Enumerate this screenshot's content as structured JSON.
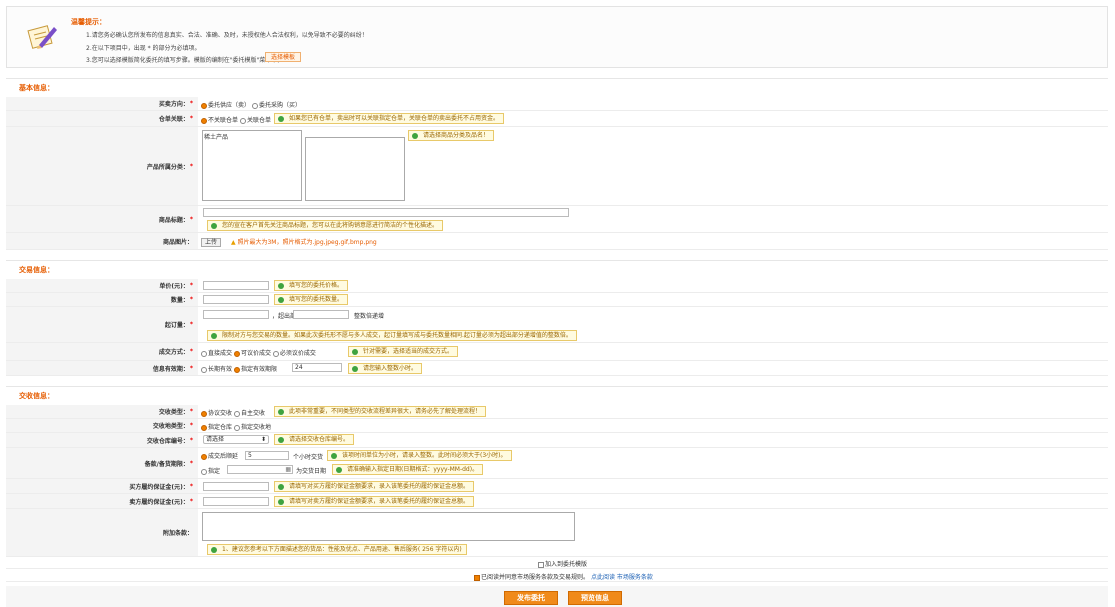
{
  "tips": {
    "title": "温馨提示：",
    "lines": [
      "1.请您务必确认您所发布的信息真实、合法、准确、及时，未授权他人合法权利，以免导致不必要的纠纷！",
      "2.在以下项目中，出现 * 的部分为必填项。",
      "3.您可以选择模版简化委托的填写步骤。模版的编制在\"委托模版\"菜单下。"
    ],
    "template_button": "选择模板"
  },
  "basic": {
    "heading": "基本信息：",
    "direction": {
      "label": "买卖方向：",
      "opt1": "委托供应（卖）",
      "opt2": "委托采购（买）"
    },
    "warehouse": {
      "label": "仓单关联：",
      "opt1": "不关联仓单",
      "opt2": "关联仓单",
      "hint": "如果您已有仓单，卖出时可以关联指定仓单，关联仓单的卖出委托不占用资金。"
    },
    "category": {
      "label": "产品所属分类：",
      "list1": [
        "稀土产品"
      ],
      "hint": "请选择商品分类及品名！"
    },
    "title": {
      "label": "商品标题：",
      "value": "",
      "hint": "您的宣在客户首先关注商品标题，您可以在此将购销意愿进行简洁的个性化描述。"
    },
    "image": {
      "label": "商品图片：",
      "upload": "上传",
      "note": "照片最大为3M，照片格式为.jpg,jpeg,gif,bmp,png"
    }
  },
  "trade": {
    "heading": "交易信息：",
    "price": {
      "label": "单价(元)：",
      "hint": "填写您的委托价格。"
    },
    "qty": {
      "label": "数量：",
      "hint": "填写您的委托数量。"
    },
    "min": {
      "label": "起订量：",
      "mid": "，超出部分按",
      "tail": "整数倍递增",
      "hint": "限制对方与您交易的数量。如果此次委托形不愿与多人成交，起订量填写成与委托数量相同.起订量必须为超出部分递增值的整数倍。"
    },
    "deal": {
      "label": "成交方式：",
      "opt1": "直接成交",
      "opt2": "可议价成交",
      "opt3": "必须议价成交",
      "hint": "针对需要，选择适当的成交方式。"
    },
    "valid": {
      "label": "信息有效期：",
      "opt1": "长期有效",
      "opt2": "指定有效期限",
      "value": "24",
      "hint": "请您输入整数小时。"
    }
  },
  "delivery": {
    "heading": "交收信息：",
    "type": {
      "label": "交收类型：",
      "opt1": "协议交收",
      "opt2": "自主交收",
      "hint": "此项非常重要，不同类型的交收流程差异很大，请务必先了解处理流程！"
    },
    "place": {
      "label": "交收地类型：",
      "opt1": "指定仓库",
      "opt2": "指定交收地"
    },
    "wh_no": {
      "label": "交收仓库编号：",
      "select": "请选择",
      "hint": "请选择交收仓库编号。"
    },
    "deadline": {
      "label": "备款/备货期限：",
      "opt1": "成交后顺延",
      "hours": "5",
      "unit": "个小时交货",
      "hint1": "该项时间单位为小时，请录入整数。此时间必须大于(3小时)。",
      "opt2": "指定",
      "suffix": "为交货日期",
      "hint2": "请准确输入指定日期(日期格式：yyyy-MM-dd)。"
    },
    "buyer_dep": {
      "label": "买方履约保证金(元)：",
      "hint": "请填写对买方履约保证金额要求，录入该笔委托的履约保证金总额。"
    },
    "seller_dep": {
      "label": "卖方履约保证金(元)：",
      "hint": "请填写对卖方履约保证金额要求，录入该笔委托的履约保证金总额。"
    },
    "extra": {
      "label": "附加条款：",
      "hint": "1、建议您参考以下方面描述您的货品：性能及优点、产品用途、售后服务( 256 字符以内)"
    }
  },
  "footer": {
    "add_tpl": "加入到委托模版",
    "agree": "已阅读并同意市场服务条款及交易规则。",
    "link1": "点此阅读",
    "link2": "市场服务条款",
    "publish": "发布委托",
    "preview": "预览信息"
  },
  "colors": {
    "accent": "#e65c00",
    "label_bg": "#f4f4f4",
    "hint_bg": "#fffbe0"
  },
  "icons": {
    "tips": "note-pencil-icon",
    "hint": "green-info-icon",
    "warn": "warning-triangle-icon",
    "calendar": "calendar-icon"
  }
}
